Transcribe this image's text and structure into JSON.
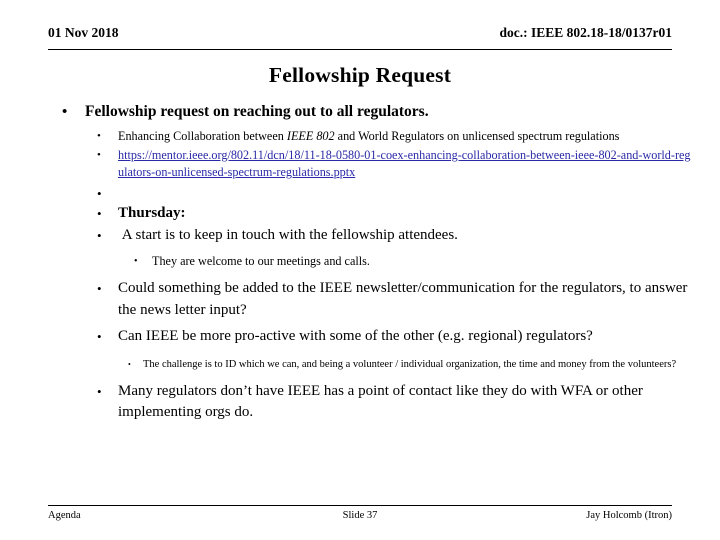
{
  "header": {
    "date": "01 Nov 2018",
    "doc": "doc.: IEEE 802.18-18/0137r01"
  },
  "title": "Fellowship Request",
  "colors": {
    "link": "#2a2aa8",
    "text": "#000000",
    "background": "#ffffff"
  },
  "bullet_glyph": "•",
  "content": {
    "b0": "Fellowship request on reaching out to all regulators.",
    "b1_part1": "Enhancing Collaboration between ",
    "b1_italic": "IEEE 802",
    "b1_part2": " and World Regulators on unlicensed spectrum regulations",
    "b2_link": "https://mentor.ieee.org/802.11/dcn/18/11-18-0580-01-coex-enhancing-collaboration-between-ieee-802-and-world-regulators-on-unlicensed-spectrum-regulations.pptx",
    "b3_empty": "",
    "b4": "Thursday:",
    "b5": "A start is to keep in touch with the fellowship attendees.",
    "b6": "They are welcome to our meetings and calls.",
    "b7": "Could something be added to the IEEE newsletter/communication for the regulators, to answer the news letter input?",
    "b8": "Can IEEE be more pro-active with some of the other (e.g. regional) regulators?",
    "b9": "The challenge is to ID which we can, and being a volunteer  / individual organization, the time and money from the volunteers?",
    "b10": "Many regulators don’t have IEEE has a point of contact like they do with WFA or other implementing orgs do."
  },
  "footer": {
    "left": "Agenda",
    "center": "Slide 37",
    "right": "Jay Holcomb (Itron)"
  }
}
